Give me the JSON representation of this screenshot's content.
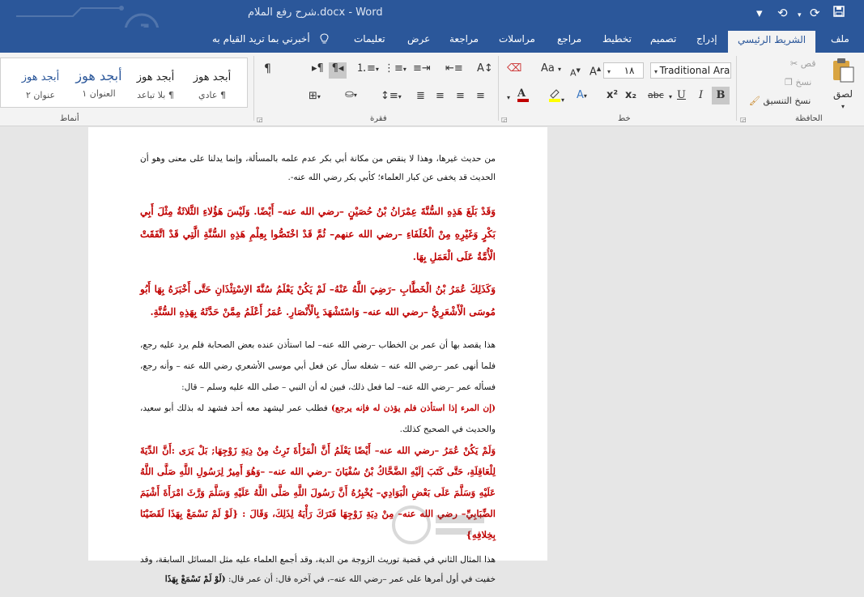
{
  "titlebar": {
    "title": "شرح رفع الملام.docx  -  Word",
    "save_icon": "save-icon",
    "undo_icon": "undo-icon",
    "redo_icon": "redo-icon",
    "customize_icon": "customize-icon",
    "bg_color": "#2b579a"
  },
  "tabs": {
    "file": "ملف",
    "home": "الشريط الرئيسي",
    "insert": "إدراج",
    "design": "تصميم",
    "layout": "تخطيط",
    "references": "مراجع",
    "mailings": "مراسلات",
    "review": "مراجعة",
    "view": "عرض",
    "help": "تعليمات",
    "tell_me": "أخبرني بما تريد القيام به"
  },
  "ribbon": {
    "clipboard": {
      "label": "الحافظة",
      "paste": "لصق",
      "cut": "قص",
      "copy": "نسخ",
      "format_painter": "نسخ التنسيق"
    },
    "font": {
      "label": "خط",
      "font_name": "Traditional Arabic",
      "font_size": "١٨",
      "bold": "B",
      "italic": "I",
      "underline": "U",
      "strike": "abc",
      "subscript": "x₂",
      "superscript": "x²",
      "grow": "A",
      "shrink": "A",
      "case": "Aa"
    },
    "paragraph": {
      "label": "فقرة"
    },
    "styles": {
      "label": "أنماط",
      "items": [
        {
          "preview": "أبجد هوز",
          "name": "¶ عادي"
        },
        {
          "preview": "أبجد هوز",
          "name": "¶ بلا تباعد"
        },
        {
          "preview": "أبجد هوز",
          "name": "العنوان ١"
        },
        {
          "preview": "أبجد هوز",
          "name": "عنوان ٢"
        }
      ]
    }
  },
  "document": {
    "p1": "من حديث غيرها، وهذا لا ينقص من مكانة أبي بكر عدم علمه بالمسألة، وإنما يدلنا على معنى وهو أن الحديث قد يخفى عن كبار العلماء؛ كأبي بكر رضي الله عنه-.",
    "p2": "وَقَدْ بَلَغَ هَذِهِ السُّنَّةَ عِمْرَانُ بْنُ حُصَيْنٍ –رضي الله عنه– أَيْضًا. وَلَيْسَ هَؤُلاءِ الثَّلاثَةُ مِثْلَ أَبِي بَكْرٍ وَغَيْرِهِ مِنْ الْخُلَفَاءِ –رضي الله عنهم– ثُمَّ قَدْ اخْتَصُّوا بِعِلْمِ هَذِهِ السُّنَّةِ الَّتِي قَدْ اتَّفَقَتْ الْأُمَّةُ عَلَى الْعَمَلِ بِهَا.",
    "p3": "وَكَذَلِكَ عُمَرُ بْنُ الْخَطَّابِ –رَضِيَ اللَّهُ عَنْهُ– لَمْ يَكُنْ يَعْلَمُ سُنَّةَ الاِسْتِئْذَانِ حَتَّى أَخْبَرَهُ بِهَا أَبُو مُوسَى الْأَشْعَرِيُّ –رضي الله عنه– وَاسْتَشْهَدَ بِالْأَنْصَارِ. عُمَرُ أَعْلَمُ مِمَّنْ حَدَّثَهُ بِهَذِهِ السُّنَّةِ.",
    "p4": "هذا يقصد بها أن عمر بن الخطاب –رضي الله عنه– لما استأذن عنده بعض الصحابة فلم يرد عليه رجع، فلما أنهى عمر –رضي الله عنه – شغله سأل عن فعل أبي موسى الأشعري رضي الله عنه – وأنه رجع، فسأله عمر –رضي الله عنه– لما فعل ذلك، فبين له أن النبي – صلى الله عليه وسلم – قال:",
    "p5_quote": "(إن المرء إذا استأذن فلم يؤذن له فإنه يرجع)",
    "p5_rest": " فطلب عمر ليشهد معه أحد فشهد له بذلك أبو سعيد، والحديث في الصحيح كذلك.",
    "p6": "وَلَمْ يَكُنْ عُمَرُ –رضي الله عنه– أَيْضًا يَعْلَمُ أَنَّ الْمَرْأَةَ تَرِثُ مِنْ دِيَةِ زَوْجِهَا; بَلْ يَرَى :أَنَّ الدِّيَةَ لِلْعَاقِلَةِ، حَتَّى كَتَبَ إلَيْهِ الضَّحَّاكُ بْنُ سُفْيَانَ –رضي الله عنه– –وَهُوَ أَمِيرٌ لِرَسُولِ اللَّهِ صَلَّى اللَّهُ عَلَيْهِ وَسَلَّمَ عَلَى بَعْضِ الْبَوَادِي– يُخْبِرُهُ أَنَّ رَسُولَ اللَّهِ صَلَّى اللَّهُ عَلَيْهِ وَسَلَّمَ وَرَّثَ امْرَأَةَ أَشْيَمَ الضِّبَابِيِّ– رضي الله عنه– مِنْ دِيَةِ زَوْجِهَا فَتَرَكَ رَأْيَهُ لِذَلِكَ، وَقَالَ : {لَوْ لَمْ نَسْمَعْ بِهَذَا لَقَضَيْنَا بِخِلافِهِ}",
    "p7_a": "هذا المثال الثاني في قضية توريث الزوجة من الدية، وقد أجمع العلماء عليه مثل المسائل السابقة، وقد خفيت في أول أمرها على عمر –رضي الله عنه–، في آخره قال: أن عمر قال: ",
    "p7_quote": "(لَوْ لَمْ نَسْمَعْ بِهَذَا"
  },
  "colors": {
    "accent": "#2b579a",
    "quote_red": "#c00000",
    "active_tab_text": "#2b579a"
  }
}
